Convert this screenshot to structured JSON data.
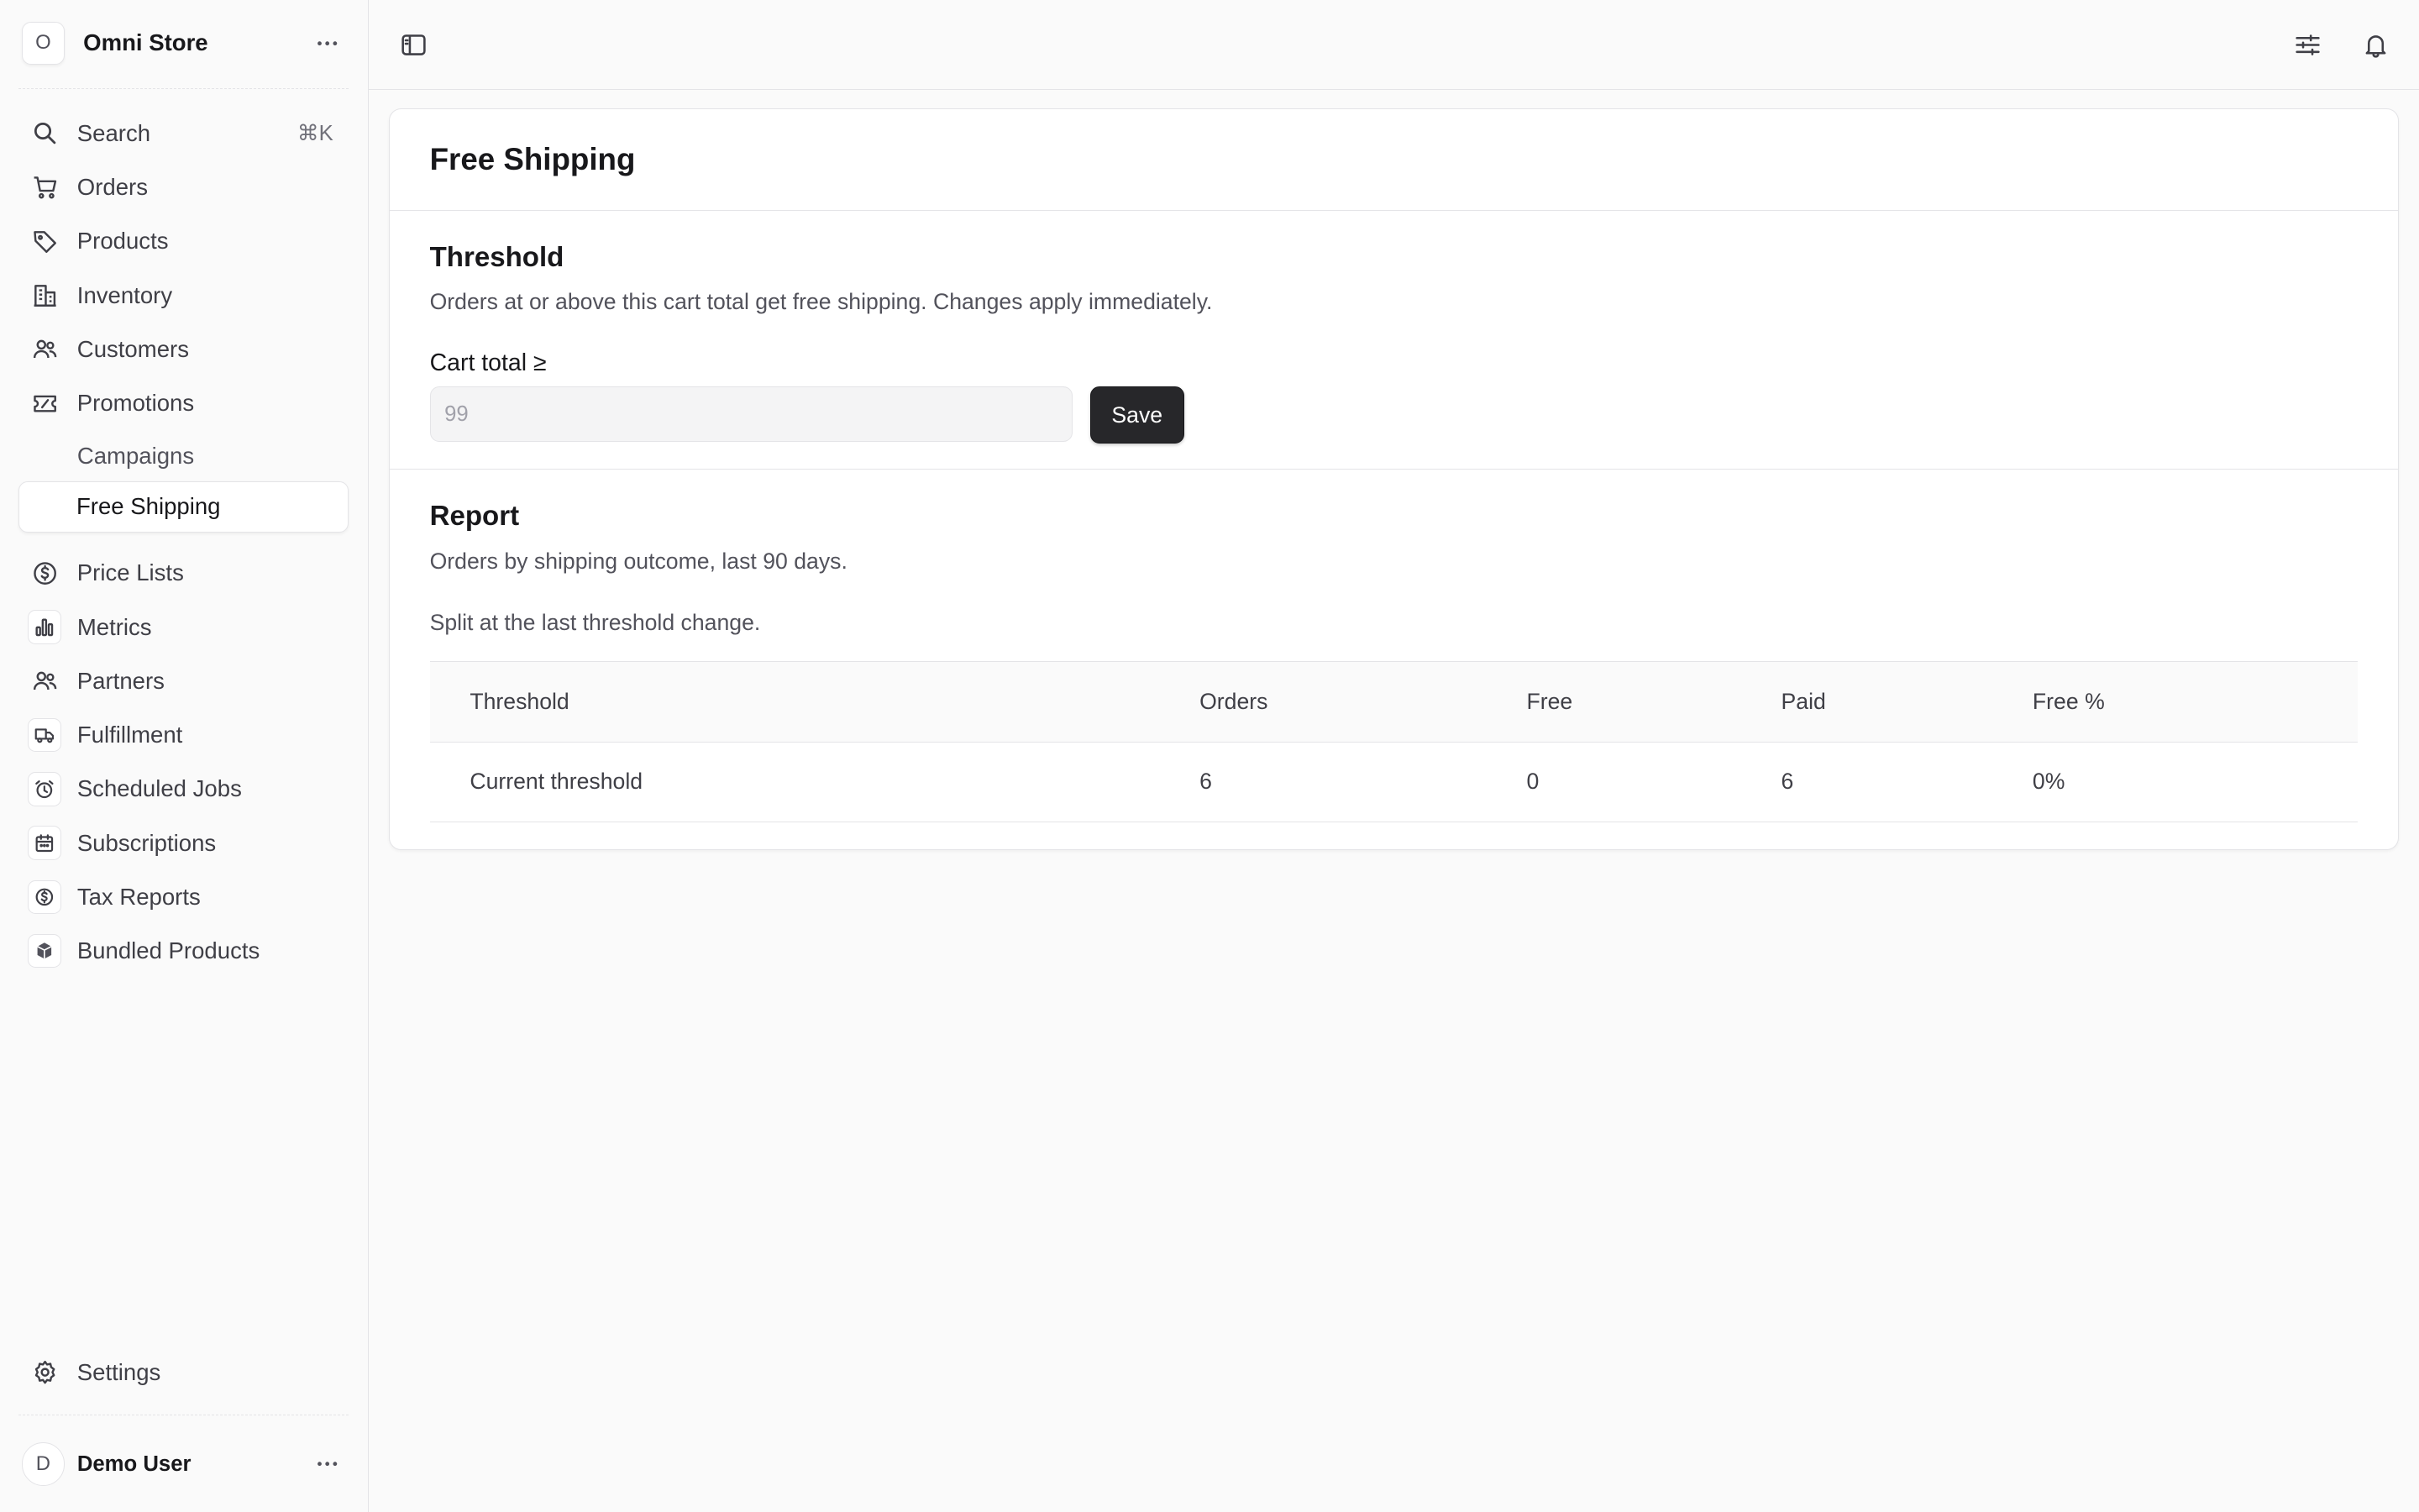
{
  "store": {
    "initial": "O",
    "name": "Omni Store"
  },
  "nav": {
    "search": {
      "label": "Search",
      "shortcut": "⌘K"
    },
    "items": [
      {
        "label": "Orders",
        "icon": "cart-icon"
      },
      {
        "label": "Products",
        "icon": "tag-icon"
      },
      {
        "label": "Inventory",
        "icon": "building-icon"
      },
      {
        "label": "Customers",
        "icon": "users-icon"
      },
      {
        "label": "Promotions",
        "icon": "ticket-icon"
      }
    ],
    "sub_items": [
      {
        "label": "Campaigns",
        "active": false
      },
      {
        "label": "Free Shipping",
        "active": true
      }
    ],
    "extensions": [
      {
        "label": "Price Lists",
        "icon": "dollar-circle-icon"
      },
      {
        "label": "Metrics",
        "icon": "bar-chart-icon"
      },
      {
        "label": "Partners",
        "icon": "users-icon"
      },
      {
        "label": "Fulfillment",
        "icon": "truck-icon"
      },
      {
        "label": "Scheduled Jobs",
        "icon": "alarm-clock-icon"
      },
      {
        "label": "Subscriptions",
        "icon": "calendar-icon"
      },
      {
        "label": "Tax Reports",
        "icon": "dollar-circle-icon"
      },
      {
        "label": "Bundled Products",
        "icon": "cube-icon"
      }
    ],
    "settings": {
      "label": "Settings"
    }
  },
  "user": {
    "initial": "D",
    "name": "Demo User"
  },
  "page": {
    "title": "Free Shipping",
    "threshold": {
      "title": "Threshold",
      "description": "Orders at or above this cart total get free shipping. Changes apply immediately.",
      "field_label": "Cart total ≥",
      "placeholder": "99",
      "save_label": "Save"
    },
    "report": {
      "title": "Report",
      "description": "Orders by shipping outcome, last 90 days.",
      "note": "Split at the last threshold change.",
      "columns": [
        "Threshold",
        "Orders",
        "Free",
        "Paid",
        "Free %"
      ],
      "rows": [
        [
          "Current threshold",
          "6",
          "0",
          "6",
          "0%"
        ]
      ]
    }
  }
}
